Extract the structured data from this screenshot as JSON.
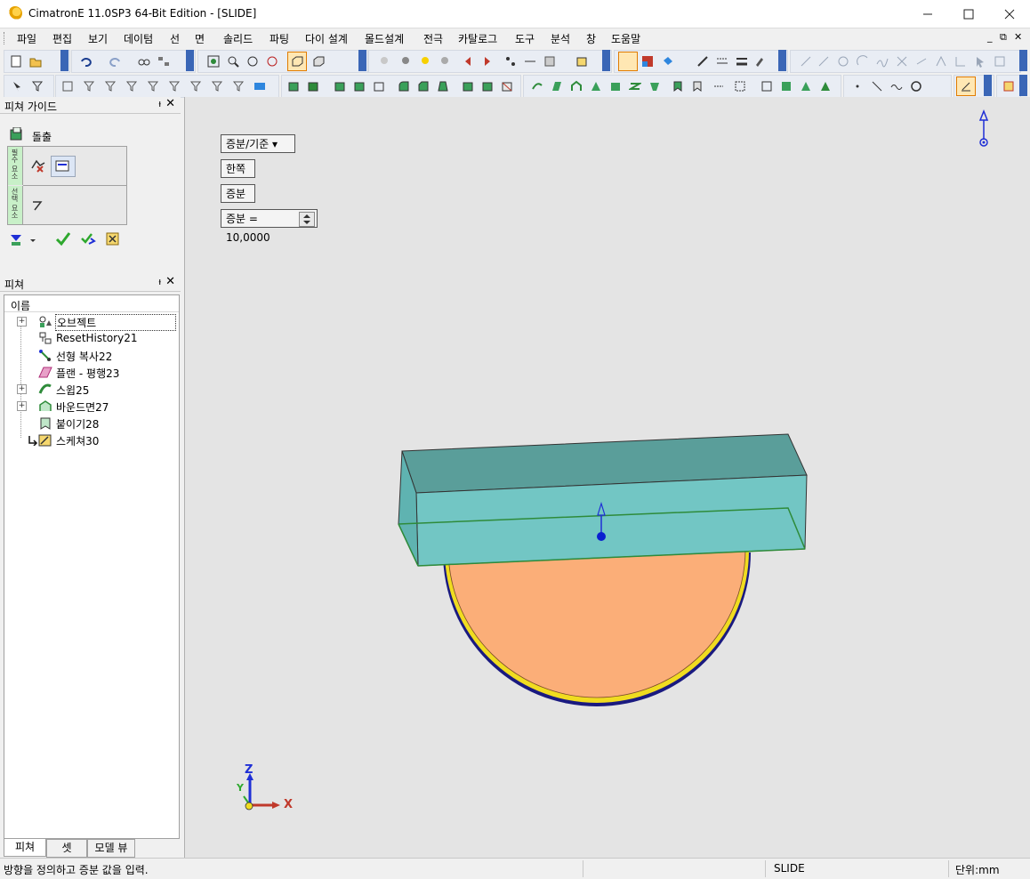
{
  "window": {
    "title": "CimatronE 11.0SP3 64-Bit Edition - [SLIDE]",
    "min_icon": "minimize-icon",
    "max_icon": "maximize-icon",
    "close_icon": "close-icon"
  },
  "menu": {
    "items": [
      "파일",
      "편집",
      "보기",
      "데이텀",
      "선",
      "면",
      "솔리드",
      "파팅",
      "다이 설계",
      "몰드설계",
      "전극",
      "카탈로그",
      "도구",
      "분석",
      "창",
      "도움말"
    ]
  },
  "mdi": {
    "minimize": "_",
    "restore": "⧉",
    "close": "✕"
  },
  "guide_panel": {
    "title": "피쳐 가이드",
    "pin": "ᵼ",
    "close": "✕",
    "command_label": "돌출",
    "steps": [
      "필수 요소",
      "선택 요소"
    ]
  },
  "features_panel": {
    "title": "피쳐",
    "pin": "ᵼ",
    "close": "✕",
    "column_header": "이름",
    "items": [
      {
        "label": "오브젝트",
        "expand": "+"
      },
      {
        "label": "ResetHistory21",
        "expand": ""
      },
      {
        "label": "선형 복사22",
        "expand": ""
      },
      {
        "label": "플랜 - 평행23",
        "expand": ""
      },
      {
        "label": "스윕25",
        "expand": "+"
      },
      {
        "label": "바운드면27",
        "expand": "+"
      },
      {
        "label": "붙이기28",
        "expand": ""
      },
      {
        "label": "스케쳐30",
        "expand": ""
      }
    ],
    "tabs": [
      "피쳐",
      "셋",
      "모델 뷰"
    ]
  },
  "viewport": {
    "controls": {
      "mode_dropdown": "증분/기준 ▾",
      "side_button": "한쪽",
      "type_button": "증분",
      "increment_field": "증분 = 10,0000"
    },
    "axes": {
      "z": "Z",
      "y": "Y",
      "x": "X"
    },
    "colors": {
      "box_top": "#5a9e9a",
      "box_front": "#72c6c4",
      "sphere": "#fbae78",
      "edge_green": "#2e8b3a",
      "arrow_blue": "#1f2fd6"
    }
  },
  "status": {
    "message": "방향을 정의하고 증분 값을 입력.",
    "mode": "SLIDE",
    "units": "단위:mm"
  }
}
